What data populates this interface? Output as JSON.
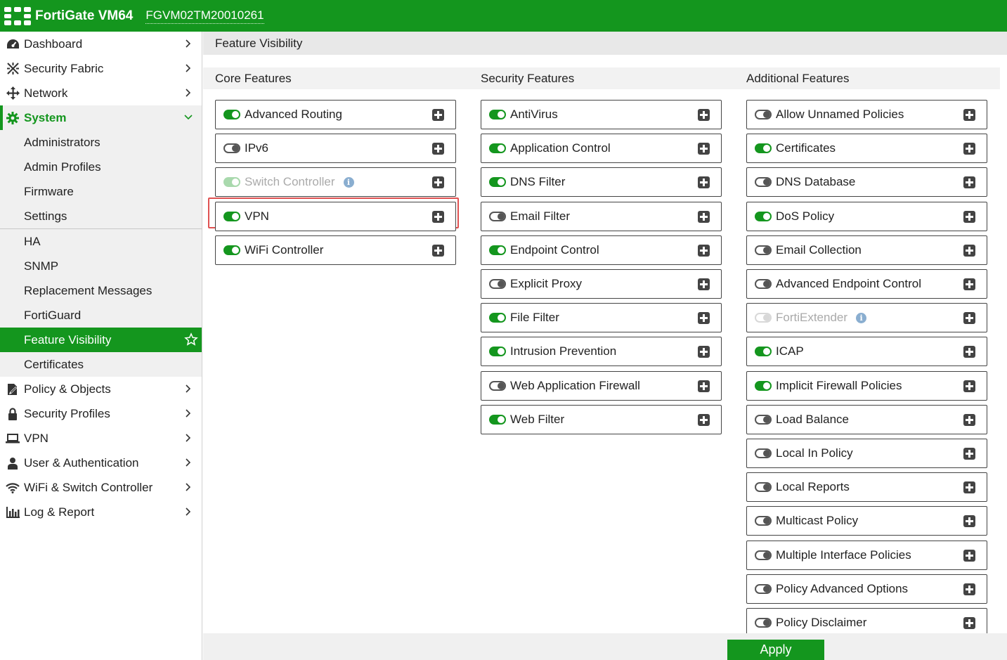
{
  "header": {
    "app_title": "FortiGate VM64",
    "serial": "FGVM02TM20010261",
    "brand_color": "#14961e"
  },
  "sidebar": {
    "items": [
      {
        "label": "Dashboard",
        "icon": "dashboard-icon"
      },
      {
        "label": "Security Fabric",
        "icon": "fabric-icon"
      },
      {
        "label": "Network",
        "icon": "network-icon"
      },
      {
        "label": "System",
        "icon": "gear-icon",
        "expanded": true
      },
      {
        "label": "Policy & Objects",
        "icon": "policy-icon"
      },
      {
        "label": "Security Profiles",
        "icon": "lock-icon"
      },
      {
        "label": "VPN",
        "icon": "laptop-icon"
      },
      {
        "label": "User & Authentication",
        "icon": "user-icon"
      },
      {
        "label": "WiFi & Switch Controller",
        "icon": "wifi-icon"
      },
      {
        "label": "Log & Report",
        "icon": "chart-icon"
      }
    ],
    "system_children": [
      {
        "label": "Administrators"
      },
      {
        "label": "Admin Profiles"
      },
      {
        "label": "Firmware"
      },
      {
        "label": "Settings"
      },
      {
        "label": "HA"
      },
      {
        "label": "SNMP"
      },
      {
        "label": "Replacement Messages"
      },
      {
        "label": "FortiGuard"
      },
      {
        "label": "Feature Visibility",
        "active": true
      },
      {
        "label": "Certificates"
      }
    ]
  },
  "main": {
    "page_title": "Feature Visibility",
    "core": {
      "title": "Core Features",
      "items": [
        {
          "label": "Advanced Routing",
          "enabled": true
        },
        {
          "label": "IPv6",
          "enabled": false
        },
        {
          "label": "Switch Controller",
          "enabled": true,
          "disabled": true,
          "info": true
        },
        {
          "label": "VPN",
          "enabled": true,
          "highlighted": true
        },
        {
          "label": "WiFi Controller",
          "enabled": true
        }
      ]
    },
    "security": {
      "title": "Security Features",
      "items": [
        {
          "label": "AntiVirus",
          "enabled": true
        },
        {
          "label": "Application Control",
          "enabled": true
        },
        {
          "label": "DNS Filter",
          "enabled": true
        },
        {
          "label": "Email Filter",
          "enabled": false
        },
        {
          "label": "Endpoint Control",
          "enabled": true
        },
        {
          "label": "Explicit Proxy",
          "enabled": false
        },
        {
          "label": "File Filter",
          "enabled": true
        },
        {
          "label": "Intrusion Prevention",
          "enabled": true
        },
        {
          "label": "Web Application Firewall",
          "enabled": false
        },
        {
          "label": "Web Filter",
          "enabled": true
        }
      ]
    },
    "additional": {
      "title": "Additional Features",
      "items": [
        {
          "label": "Allow Unnamed Policies",
          "enabled": false
        },
        {
          "label": "Certificates",
          "enabled": true
        },
        {
          "label": "DNS Database",
          "enabled": false
        },
        {
          "label": "DoS Policy",
          "enabled": true
        },
        {
          "label": "Email Collection",
          "enabled": false
        },
        {
          "label": "Advanced Endpoint Control",
          "enabled": false
        },
        {
          "label": "FortiExtender",
          "enabled": false,
          "disabled": true,
          "info": true
        },
        {
          "label": "ICAP",
          "enabled": true
        },
        {
          "label": "Implicit Firewall Policies",
          "enabled": true
        },
        {
          "label": "Load Balance",
          "enabled": false
        },
        {
          "label": "Local In Policy",
          "enabled": false
        },
        {
          "label": "Local Reports",
          "enabled": false
        },
        {
          "label": "Multicast Policy",
          "enabled": false
        },
        {
          "label": "Multiple Interface Policies",
          "enabled": false
        },
        {
          "label": "Policy Advanced Options",
          "enabled": false
        },
        {
          "label": "Policy Disclaimer",
          "enabled": false
        }
      ]
    },
    "apply_label": "Apply"
  }
}
